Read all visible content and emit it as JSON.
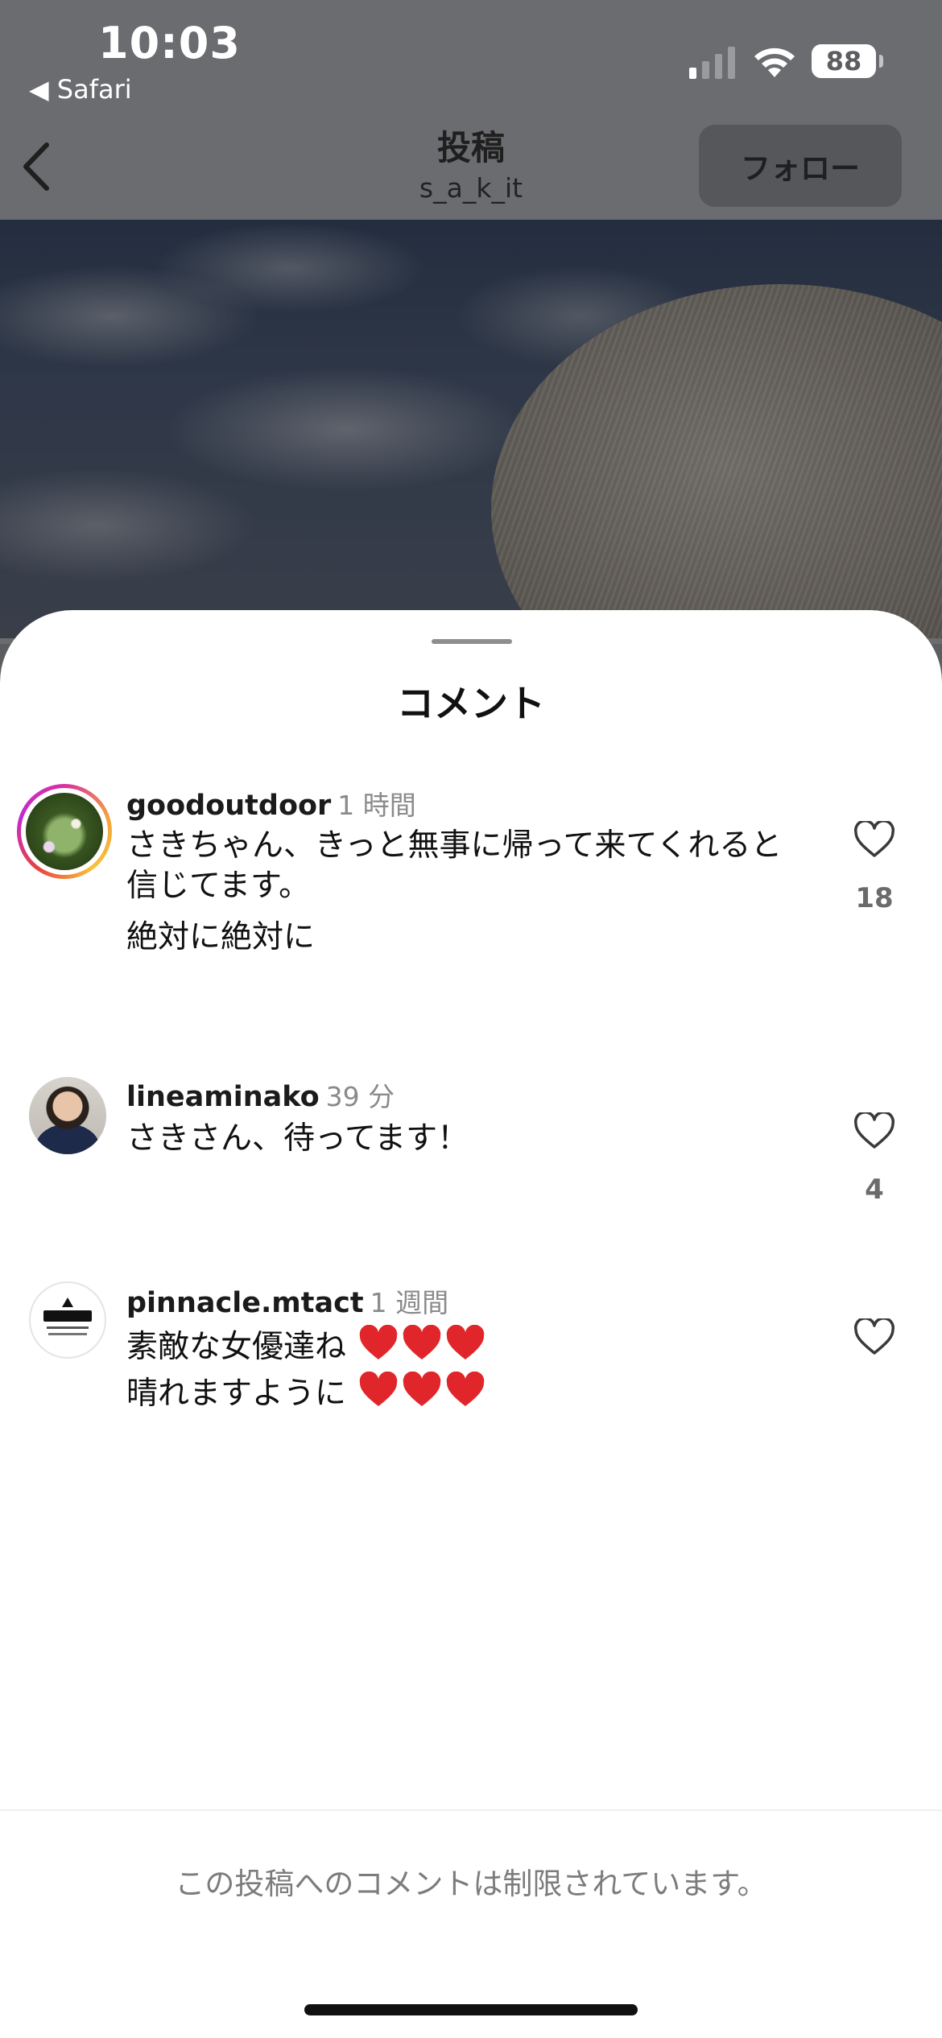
{
  "status_bar": {
    "time": "10:03",
    "back_app": "◀ Safari",
    "battery": "88"
  },
  "header": {
    "title": "投稿",
    "subtitle": "s_a_k_it",
    "follow_label": "フォロー"
  },
  "sheet": {
    "title": "コメント",
    "comments": [
      {
        "username": "goodoutdoor",
        "time": "1 時間",
        "lines": [
          "さきちゃん、きっと無事に帰って来てくれると信じてます。",
          "絶対に絶対に"
        ],
        "likes": "18"
      },
      {
        "username": "lineaminako",
        "time": "39 分",
        "lines": [
          "さきさん、待ってます！"
        ],
        "likes": "4"
      },
      {
        "username": "pinnacle.mtact",
        "time": "1 週間",
        "lines": [
          "素敵な女優達ね",
          "晴れますように"
        ],
        "likes": ""
      }
    ],
    "restricted_notice": "この投稿へのコメントは制限されています。"
  },
  "icons": {
    "back": "chevron-left-icon",
    "like": "heart-outline-icon",
    "emoji": "red-heart-emoji"
  },
  "colors": {
    "accent_red": "#e0262b",
    "story_ring": "#d92fa0"
  }
}
